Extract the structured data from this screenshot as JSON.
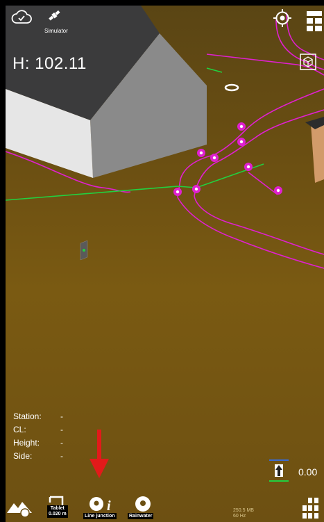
{
  "top_bar": {
    "simulator_label": "Simulator"
  },
  "readout": {
    "height": "H: 102.11"
  },
  "station_info": [
    {
      "label": "Station:",
      "value": "-"
    },
    {
      "label": "CL:",
      "value": "-"
    },
    {
      "label": "Height:",
      "value": "-"
    },
    {
      "label": "Side:",
      "value": "-"
    }
  ],
  "height_offset": {
    "value": "0.00"
  },
  "toolbar": {
    "tablet_label": "Tablet",
    "tablet_value": "0.020 m",
    "line_junction_label": "Line junction",
    "rainwater_label": "Rainwater"
  },
  "status": {
    "memory": "250.5 MB",
    "fps": "60 Hz"
  },
  "colors": {
    "ground": "#6b4f12",
    "line_magenta": "#e020d0",
    "line_green": "#22d040",
    "arrow_red": "#e21a1a"
  }
}
